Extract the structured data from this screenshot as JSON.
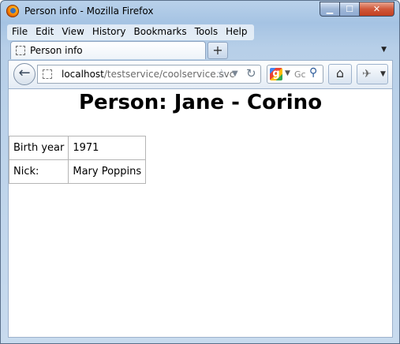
{
  "window": {
    "title": "Person info - Mozilla Firefox",
    "controls": {
      "minimize": "▁",
      "maximize": "☐",
      "close": "✕"
    }
  },
  "menu": [
    "File",
    "Edit",
    "View",
    "History",
    "Bookmarks",
    "Tools",
    "Help"
  ],
  "tabs": [
    {
      "label": "Person info",
      "icon": "page-icon"
    }
  ],
  "newtab_label": "+",
  "address": {
    "host": "localhost",
    "path": "/testservice/coolservice.svc"
  },
  "search": {
    "engine_icon": "google-icon",
    "placeholder": "Gc"
  },
  "page": {
    "heading": "Person: Jane - Corino",
    "rows": [
      {
        "label": "Birth year",
        "value": "1971"
      },
      {
        "label": "Nick:",
        "value": "Mary Poppins"
      }
    ]
  },
  "colors": {
    "chrome": "#a5c3e3",
    "close": "#c23f20"
  }
}
